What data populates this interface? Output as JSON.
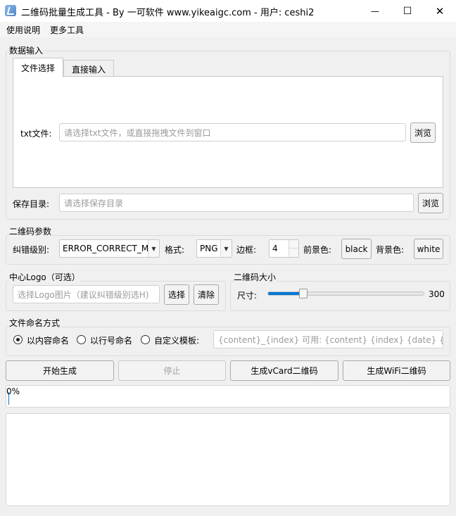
{
  "window": {
    "title": "二维码批量生成工具 - By 一可软件 www.yikeaigc.com - 用户: ceshi2",
    "minimize_glyph": "—",
    "maximize_glyph": "☐",
    "close_glyph": "✕"
  },
  "menu": {
    "items": [
      "使用说明",
      "更多工具"
    ]
  },
  "data_input": {
    "group_title": "数据输入",
    "tabs": [
      "文件选择",
      "直接输入"
    ],
    "txt_label": "txt文件:",
    "txt_placeholder": "请选择txt文件，或直接拖拽文件到窗口",
    "txt_browse": "浏览",
    "save_label": "保存目录:",
    "save_placeholder": "请选择保存目录",
    "save_browse": "浏览"
  },
  "qr_params": {
    "group_title": "二维码参数",
    "ec_label": "纠错级别:",
    "ec_value": "ERROR_CORRECT_M",
    "format_label": "格式:",
    "format_value": "PNG",
    "border_label": "边框:",
    "border_value": "4",
    "fg_label": "前景色:",
    "fg_value": "black",
    "bg_label": "背景色:",
    "bg_value": "white"
  },
  "logo": {
    "group_title": "中心Logo（可选）",
    "placeholder": "选择Logo图片（建议纠错级别选H)",
    "select_button": "选择",
    "clear_button": "清除"
  },
  "size": {
    "group_title": "二维码大小",
    "label": "尺寸:",
    "value": "300",
    "slider_fraction": 0.23
  },
  "naming": {
    "group_title": "文件命名方式",
    "options": [
      "以内容命名",
      "以行号命名",
      "自定义模板:"
    ],
    "selected": 0,
    "template_placeholder": "{content}_{index}  可用: {content} {index} {date} {time}"
  },
  "actions": {
    "start": "开始生成",
    "stop": "停止",
    "vcard": "生成vCard二维码",
    "wifi": "生成WiFi二维码"
  },
  "progress": {
    "text": "0%",
    "fraction": 0
  },
  "colors": {
    "accent": "#0078d7"
  }
}
